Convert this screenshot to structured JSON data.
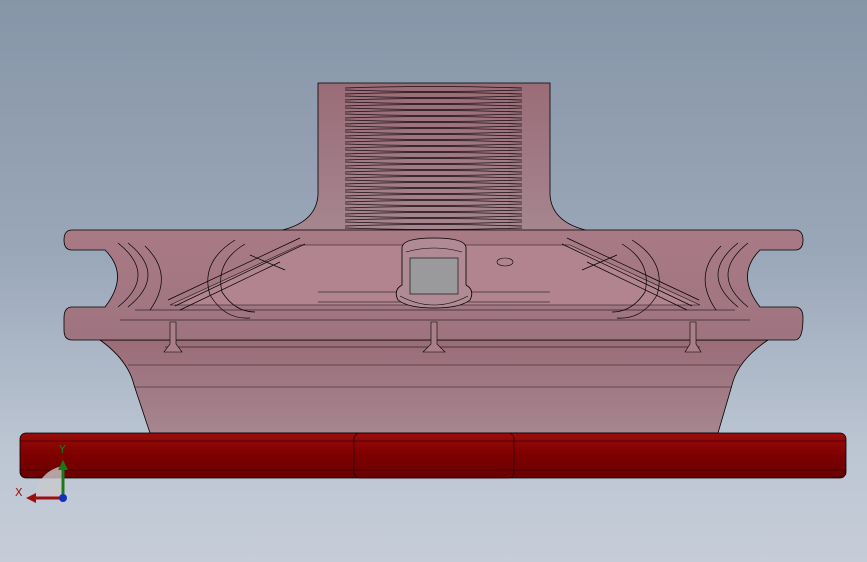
{
  "viewport": {
    "background_top": "#8795a8",
    "background_bottom": "#c6cdd8"
  },
  "model": {
    "body_color": "#9b7079",
    "body_highlight": "#c8a0a8",
    "edge_color": "#000000",
    "base_plate_color": "#7d0000",
    "base_plate_highlight": "#a01010"
  },
  "triad": {
    "x_label": "X",
    "y_label": "Y",
    "x_color": "#9a1010",
    "y_color": "#1a7a1a",
    "z_color": "#1030c0"
  }
}
